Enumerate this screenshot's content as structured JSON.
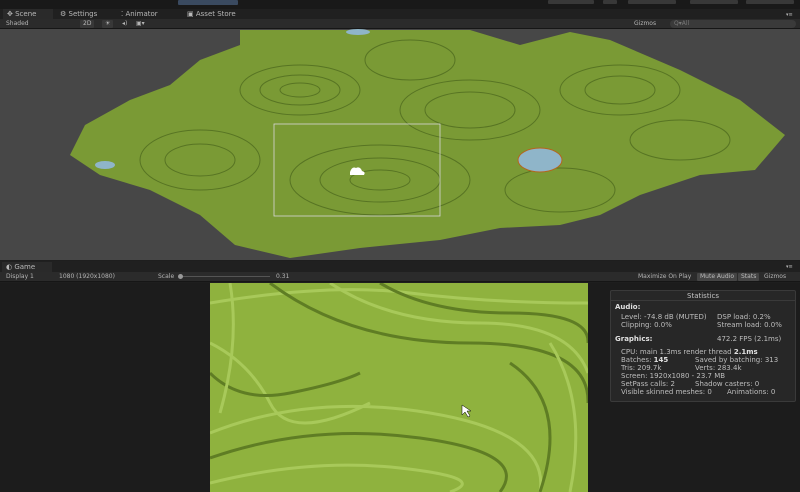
{
  "scene_tabs": [
    {
      "label": "Scene",
      "icon": "scene-icon"
    },
    {
      "label": "Settings",
      "icon": "gear-icon"
    },
    {
      "label": "Animator",
      "icon": "animator-icon"
    },
    {
      "label": "Asset Store",
      "icon": "store-icon"
    }
  ],
  "scene_toolbar": {
    "shading": "Shaded",
    "mode_2d": "2D",
    "gizmos": "Gizmos",
    "search_placeholder": "Q▾All"
  },
  "game_tab": {
    "label": "Game"
  },
  "game_toolbar": {
    "display": "Display 1",
    "resolution": "1080 (1920x1080)",
    "scale_label": "Scale",
    "scale_value": "0.31",
    "maximize": "Maximize On Play",
    "mute": "Mute Audio",
    "stats": "Stats",
    "gizmos": "Gizmos"
  },
  "stats": {
    "title": "Statistics",
    "audio_header": "Audio:",
    "level": "Level: -74.8 dB (MUTED)",
    "dsp": "DSP load: 0.2%",
    "clipping": "Clipping: 0.0%",
    "stream": "Stream load: 0.0%",
    "graphics_header": "Graphics:",
    "fps": "472.2 FPS (2.1ms)",
    "cpu_prefix": "CPU: main 1.3ms  render thread ",
    "cpu_render": "2.1ms",
    "batches_prefix": "Batches: ",
    "batches": "145",
    "saved": "Saved by batching: 313",
    "tris": "Tris: 209.7k",
    "verts": "Verts: 283.4k",
    "screen": "Screen: 1920x1080 - 23.7 MB",
    "setpass": "SetPass calls: 2",
    "shadow": "Shadow casters: 0",
    "skinned": "Visible skinned meshes: 0",
    "animations": "Animations: 0"
  },
  "colors": {
    "terrain": "#7a9a35",
    "terrain_dark": "#4f6b1f",
    "water": "#8fb5c9",
    "game_green": "#8fb23e"
  }
}
